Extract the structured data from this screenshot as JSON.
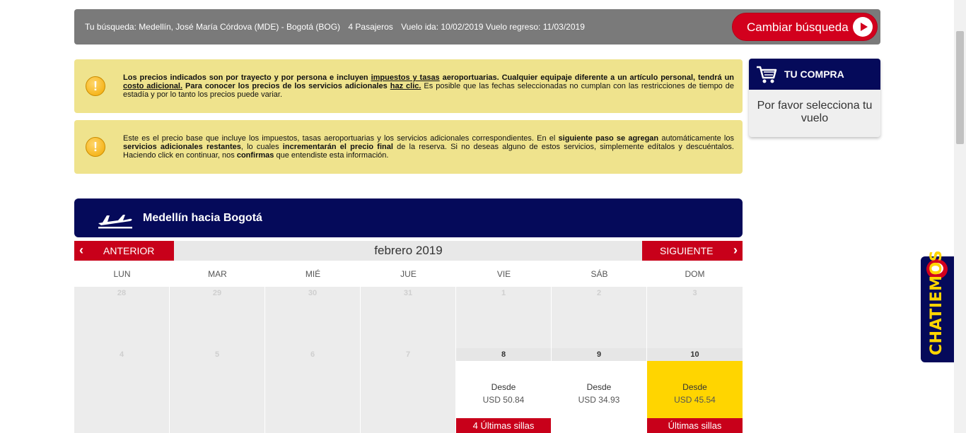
{
  "search": {
    "summary": "Tu búsqueda: Medellín, José María Córdova (MDE) - Bogotá (BOG)",
    "passengers": "4 Pasajeros",
    "dates": "Vuelo ida: 10/02/2019 Vuelo regreso: 11/03/2019",
    "change_label": "Cambiar búsqueda"
  },
  "notice1": {
    "p1": "Los precios indicados son por trayecto y por persona e incluyen ",
    "link1": "impuestos y tasas",
    "p2": " aeroportuarias. Cualquier equipaje diferente a un artículo personal, tendrá un ",
    "link2": "costo adicional.",
    "p3": " Para conocer los precios de los servicios adicionales ",
    "link3": "haz clic.",
    "p4": "  Es posible que las fechas seleccionadas no cumplan con las restricciones de tiempo de estadía y por lo tanto los precios puede variar."
  },
  "notice2": {
    "t1": "Este es el precio base que incluye los impuestos, tasas aeroportuarias y los servicios adicionales correspondientes. En el ",
    "b1": "siguiente paso se agregan",
    "t2": " automáticamente los ",
    "b2": "servicios adicionales restantes",
    "t3": ", lo cuales ",
    "b3": "incrementarán el precio final",
    "t4": " de la reserva. Si no deseas alguno de estos servicios, simplemente edítalos y descuéntalos. Haciendo click en continuar, nos ",
    "b4": "confirmas",
    "t5": " que entendiste esta información."
  },
  "cart": {
    "title": "TU COMPRA",
    "message": "Por favor selecciona tu vuelo"
  },
  "route": {
    "title": "Medellín hacia Bogotá"
  },
  "calendar": {
    "prev_label": "ANTERIOR",
    "next_label": "SIGUIENTE",
    "month": "febrero 2019",
    "weekdays": [
      "LUN",
      "MAR",
      "MIÉ",
      "JUE",
      "VIE",
      "SÁB",
      "DOM"
    ],
    "week1": [
      "28",
      "29",
      "30",
      "31",
      "1",
      "2",
      "3"
    ],
    "week2": [
      {
        "num": "4"
      },
      {
        "num": "5"
      },
      {
        "num": "6"
      },
      {
        "num": "7"
      },
      {
        "num": "8",
        "from": "Desde",
        "price": "USD 50.84",
        "badge": "4 Últimas sillas"
      },
      {
        "num": "9",
        "from": "Desde",
        "price": "USD 34.93"
      },
      {
        "num": "10",
        "from": "Desde",
        "price": "USD 45.54",
        "badge": "Últimas sillas"
      }
    ]
  },
  "chat": {
    "label": "CHATIEMOS"
  }
}
